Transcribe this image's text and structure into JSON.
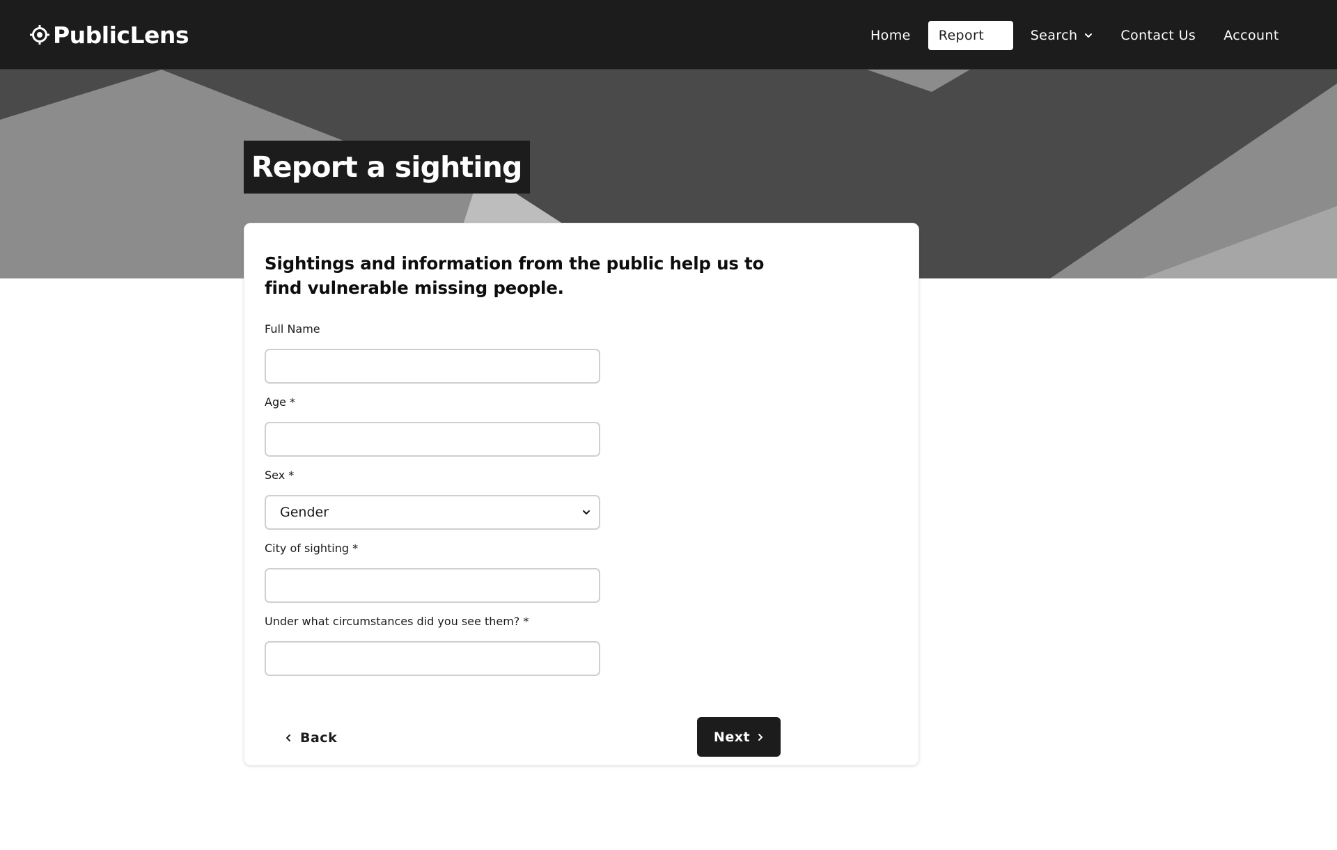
{
  "brand": {
    "name": "PublicLens",
    "logo_icon": "crosshair-icon"
  },
  "nav": {
    "items": [
      {
        "label": "Home",
        "active": false
      },
      {
        "label": "Report",
        "active": true
      },
      {
        "label": "Search",
        "active": false,
        "has_dropdown": true
      },
      {
        "label": "Contact Us",
        "active": false
      },
      {
        "label": "Account",
        "active": false
      }
    ]
  },
  "page": {
    "title": "Report a sighting"
  },
  "form": {
    "intro": "Sightings and information from the public help us to find vulnerable missing people.",
    "fields": [
      {
        "label": "Full Name",
        "value": "",
        "type": "text"
      },
      {
        "label": "Age *",
        "value": "",
        "type": "text"
      },
      {
        "label": "Sex *",
        "value": "Gender",
        "type": "select"
      },
      {
        "label": "City of sighting *",
        "value": "",
        "type": "text"
      },
      {
        "label": "Under what circumstances did you see them? *",
        "value": "",
        "type": "text"
      }
    ],
    "back_label": "Back",
    "next_label": "Next"
  },
  "colors": {
    "navbar": "#1c1c1c",
    "hero_base": "#4a4a4a",
    "hero_light": "#8c8c8c",
    "hero_lighter": "#bdbdbd",
    "primary_button": "#1c1c1c"
  }
}
